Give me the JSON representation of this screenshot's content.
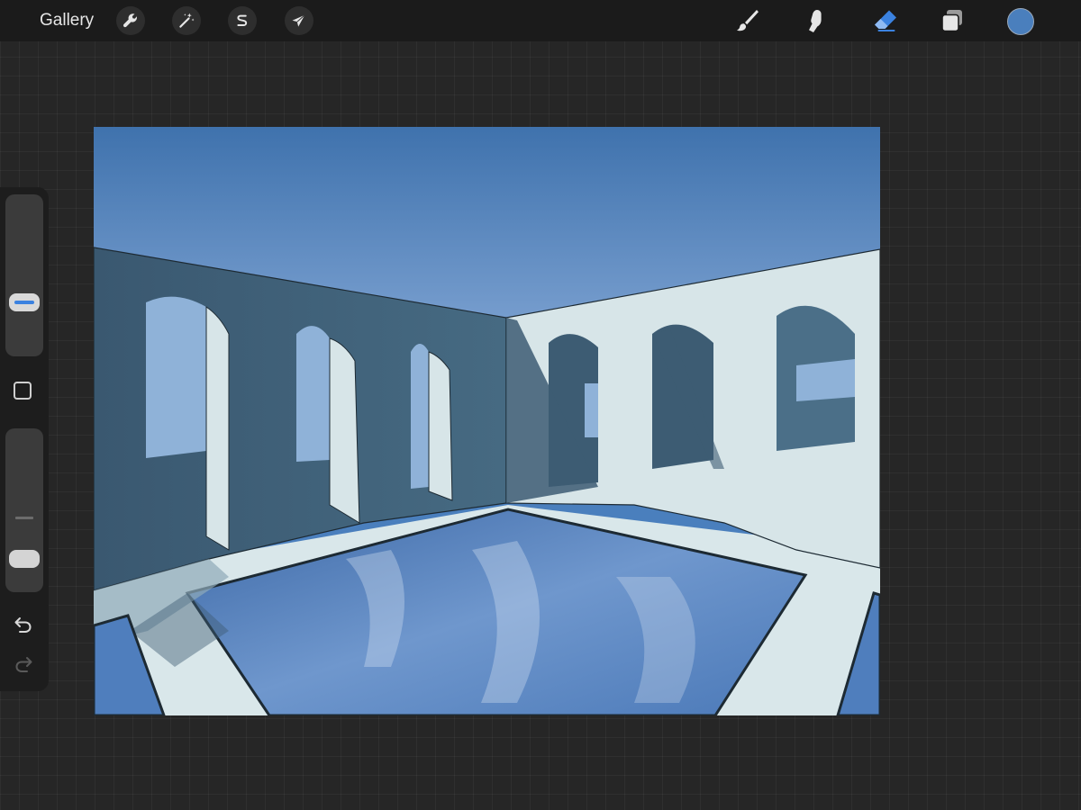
{
  "topbar": {
    "gallery_label": "Gallery",
    "left_tools": [
      {
        "name": "actions",
        "icon": "wrench-icon"
      },
      {
        "name": "adjustments",
        "icon": "magic-wand-icon"
      },
      {
        "name": "selection",
        "icon": "selection-s-icon"
      },
      {
        "name": "transform",
        "icon": "arrow-cursor-icon"
      }
    ],
    "right_tools": [
      {
        "name": "brush",
        "icon": "brush-icon",
        "active": false
      },
      {
        "name": "smudge",
        "icon": "smudge-finger-icon",
        "active": false
      },
      {
        "name": "eraser",
        "icon": "eraser-icon",
        "active": true
      },
      {
        "name": "layers",
        "icon": "layers-icon",
        "active": false
      }
    ],
    "current_color": "#4a7fbd"
  },
  "sidebar": {
    "brush_size_level": 0.3,
    "brush_opacity_level": 0.15,
    "modify_button_icon": "square-icon",
    "undo_icon": "undo-arrow-icon",
    "redo_icon": "redo-arrow-icon",
    "redo_enabled": false
  },
  "canvas": {
    "artwork": "arched-colonnade-pool-illustration",
    "colors": {
      "sky_top": "#3f72ad",
      "sky_bottom": "#6f98cc",
      "wall_shadow": "#3d5c73",
      "wall_light": "#d7e5e8",
      "water": "#5080c0",
      "water_dark": "#3c68a6",
      "floor": "#d9e7ea",
      "floor_shadow": "#8fa9b8",
      "outline": "#1d2a33"
    }
  },
  "theme": {
    "toolbar_bg": "#1b1b1b",
    "app_bg": "#262626",
    "accent": "#3b82e0"
  }
}
